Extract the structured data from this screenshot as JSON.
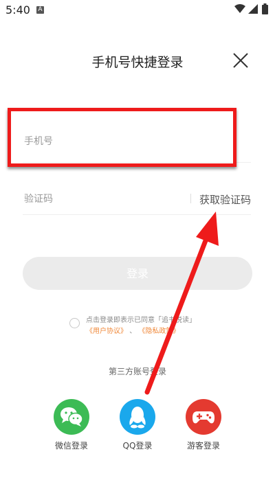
{
  "status_bar": {
    "time": "5:40",
    "a_icon_label": "A"
  },
  "header": {
    "title": "手机号快捷登录"
  },
  "form": {
    "phone_placeholder": "手机号",
    "code_placeholder": "验证码",
    "get_code_label": "获取验证码",
    "login_label": "登录"
  },
  "agreement": {
    "line1": "点击登录即表示已同意「追书悦读」",
    "user_agreement": "《用户协议》",
    "separator": "、",
    "privacy_policy": "《隐私政策》"
  },
  "third_party": {
    "title": "第三方账号登录",
    "wechat_label": "微信登录",
    "qq_label": "QQ登录",
    "guest_label": "游客登录"
  },
  "colors": {
    "highlight": "#ee1b1b",
    "annotation_arrow": "#ee1b1b",
    "wechat": "#3cbb55",
    "qq": "#1aa8ec",
    "guest": "#e43a30",
    "link": "#f08a3c"
  }
}
